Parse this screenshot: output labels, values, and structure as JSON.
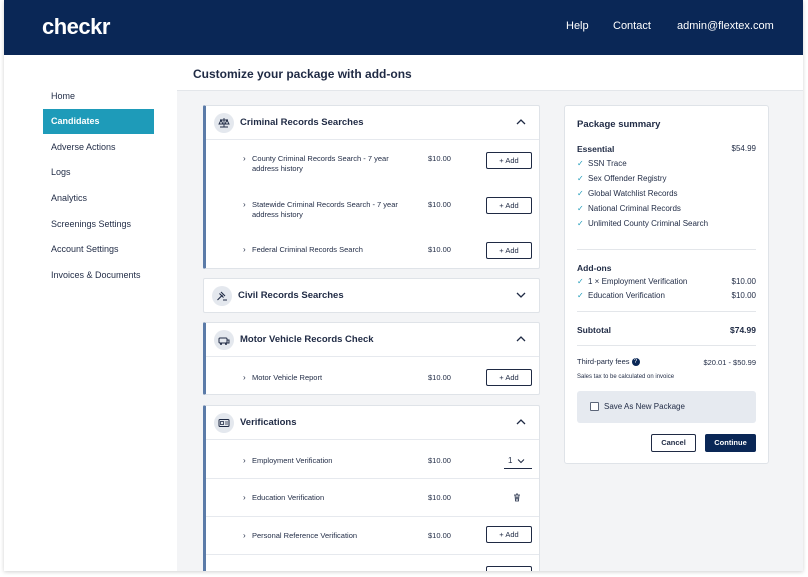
{
  "brand": {
    "logo": "checkr"
  },
  "topnav": {
    "help": "Help",
    "contact": "Contact",
    "account": "admin@flextex.com"
  },
  "sidebar": {
    "items": [
      {
        "label": "Home"
      },
      {
        "label": "Candidates"
      },
      {
        "label": "Adverse Actions"
      },
      {
        "label": "Logs"
      },
      {
        "label": "Analytics"
      },
      {
        "label": "Screenings Settings"
      },
      {
        "label": "Account Settings"
      },
      {
        "label": "Invoices & Documents"
      }
    ]
  },
  "page": {
    "title": "Customize your package with add-ons"
  },
  "sections": {
    "criminal": {
      "title": "Criminal Records Searches",
      "rows": [
        {
          "label": "County Criminal Records Search - 7 year address history",
          "price": "$10.00",
          "action": "Add"
        },
        {
          "label": "Statewide Criminal Records Search - 7 year address history",
          "price": "$10.00",
          "action": "Add"
        },
        {
          "label": "Federal Criminal Records Search",
          "price": "$10.00",
          "action": "Add"
        }
      ]
    },
    "civil": {
      "title": "Civil Records Searches"
    },
    "motor": {
      "title": "Motor Vehicle Records Check",
      "rows": [
        {
          "label": "Motor Vehicle Report",
          "price": "$10.00",
          "action": "Add"
        }
      ]
    },
    "verifications": {
      "title": "Verifications",
      "rows": [
        {
          "label": "Employment Verification",
          "price": "$10.00",
          "qty": "1"
        },
        {
          "label": "Education Verification",
          "price": "$10.00"
        },
        {
          "label": "Personal Reference Verification",
          "price": "$10.00",
          "action": "Add"
        }
      ]
    }
  },
  "summary": {
    "title": "Package summary",
    "essential_label": "Essential",
    "essential_price": "$54.99",
    "essential_items": [
      "SSN Trace",
      "Sex Offender Registry",
      "Global Watchlist Records",
      "National Criminal Records",
      "Unlimited County Criminal Search"
    ],
    "addons_label": "Add-ons",
    "addons": [
      {
        "label": "1 × Employment Verification",
        "price": "$10.00"
      },
      {
        "label": "Education Verification",
        "price": "$10.00"
      }
    ],
    "subtotal_label": "Subtotal",
    "subtotal_value": "$74.99",
    "fees_label": "Third-party fees",
    "fees_value": "$20.01 - $50.99",
    "tax_note": "Sales tax to be calculated on invoice",
    "save_label": "Save As New Package",
    "cancel_label": "Cancel",
    "continue_label": "Continue"
  },
  "colors": {
    "navy": "#0a2756",
    "teal": "#1e9bb9",
    "accent_border": "#5b7ba8"
  }
}
